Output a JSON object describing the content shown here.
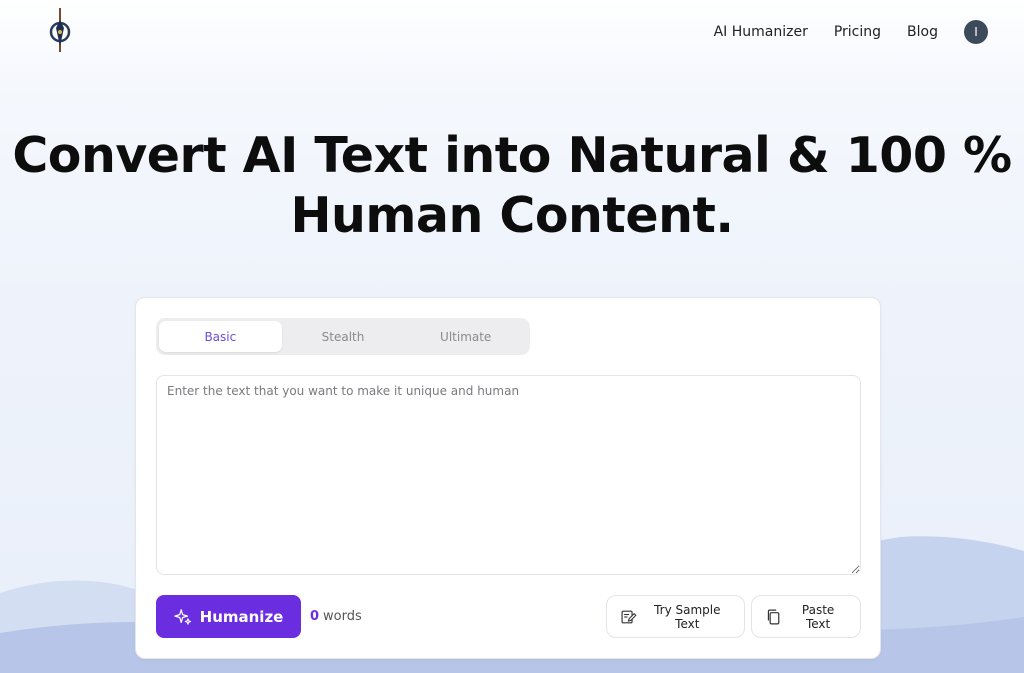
{
  "nav": {
    "links": [
      "AI Humanizer",
      "Pricing",
      "Blog"
    ],
    "avatar_initial": "I"
  },
  "hero": {
    "line1": "Convert AI Text into Natural & 100 %",
    "line2": "Human Content."
  },
  "editor": {
    "tabs": [
      {
        "label": "Basic",
        "active": true
      },
      {
        "label": "Stealth",
        "active": false
      },
      {
        "label": "Ultimate",
        "active": false
      }
    ],
    "placeholder": "Enter the text that you want to make it unique and human",
    "value": "",
    "humanize_label": "Humanize",
    "word_count": "0",
    "word_unit": "words",
    "try_sample_label": "Try Sample Text",
    "paste_label": "Paste Text"
  },
  "icons": {
    "logo": "compass-pen-logo",
    "humanize": "sparkle-icon",
    "sample": "edit-document-icon",
    "paste": "copy-icon"
  },
  "colors": {
    "accent": "#6a2ee0",
    "active_tab_text": "#6c4cdb",
    "avatar_bg": "#3e4a5c"
  }
}
